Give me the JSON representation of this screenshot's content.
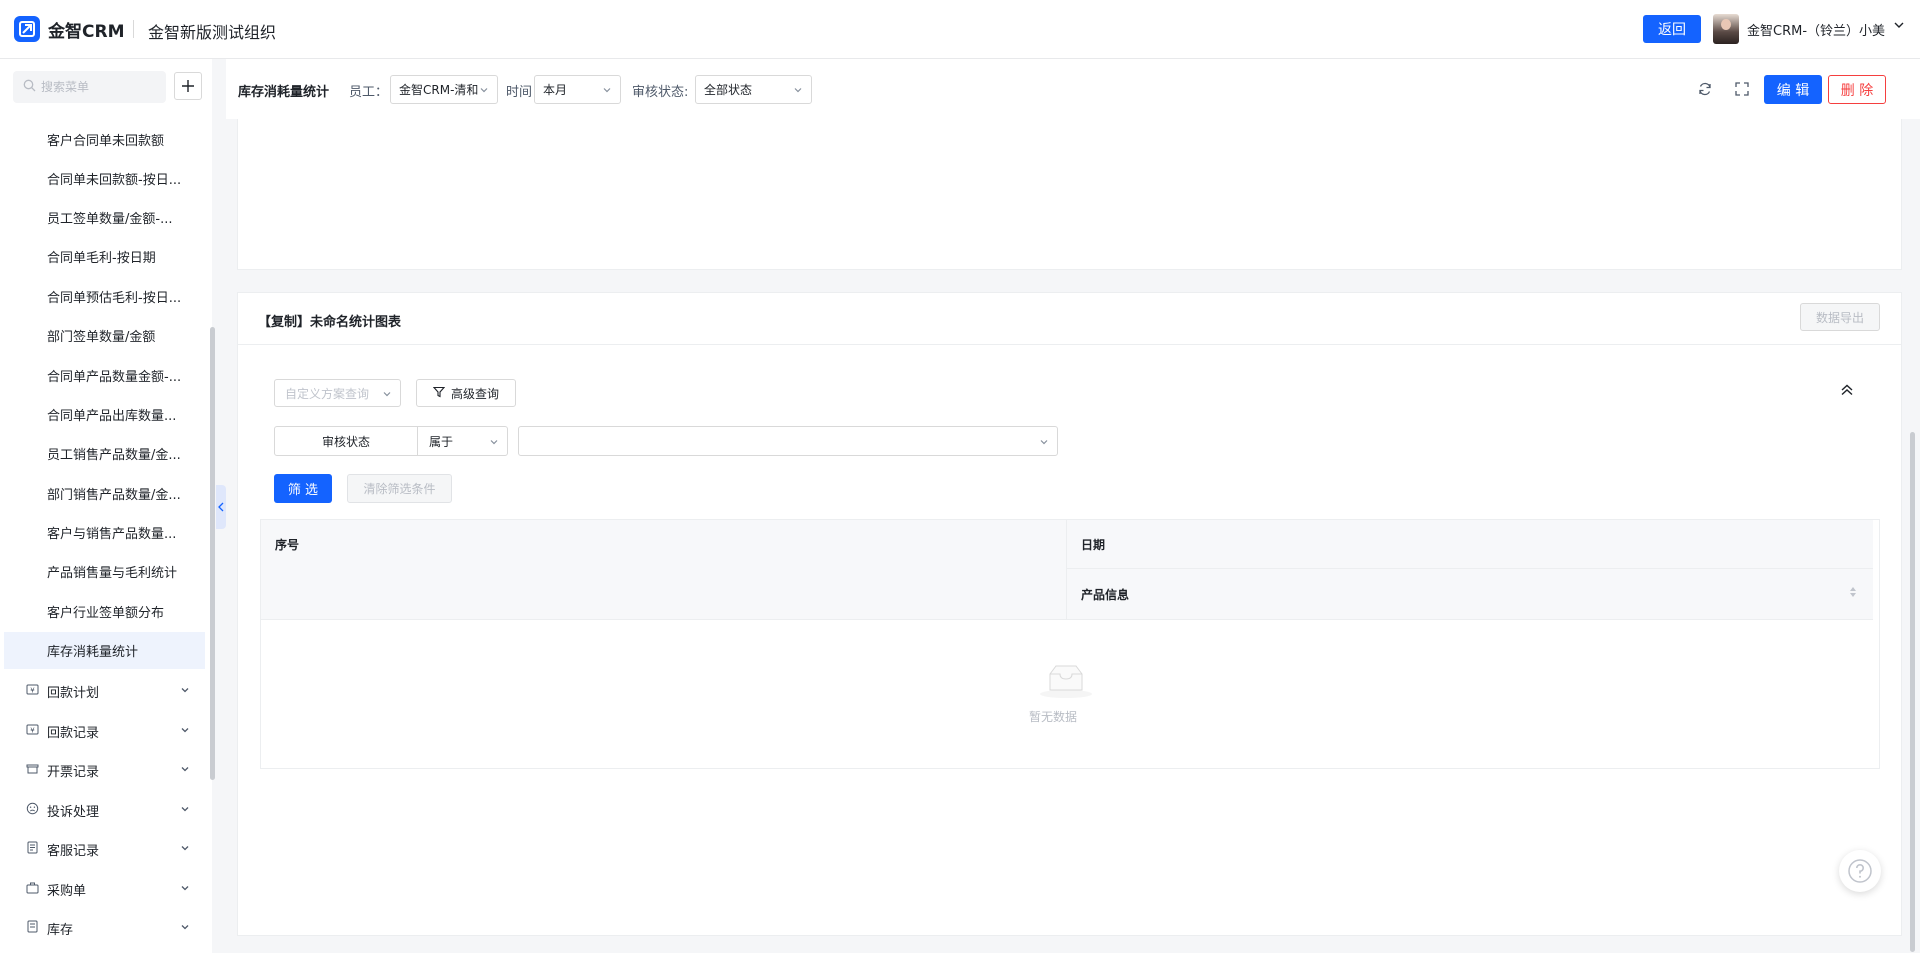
{
  "topbar": {
    "logo_text": "金智CRM",
    "org_name": "金智新版测试组织",
    "back_label": "返回",
    "user_name": "金智CRM-（铃兰）小美"
  },
  "sidebar": {
    "search_placeholder": "搜索菜单",
    "items": [
      {
        "label": "客户合同单未回款额"
      },
      {
        "label": "合同单未回款额-按日..."
      },
      {
        "label": "员工签单数量/金额-..."
      },
      {
        "label": "合同单毛利-按日期"
      },
      {
        "label": "合同单预估毛利-按日..."
      },
      {
        "label": "部门签单数量/金额"
      },
      {
        "label": "合同单产品数量金额-..."
      },
      {
        "label": "合同单产品出库数量..."
      },
      {
        "label": "员工销售产品数量/金..."
      },
      {
        "label": "部门销售产品数量/金..."
      },
      {
        "label": "客户与销售产品数量..."
      },
      {
        "label": "产品销售量与毛利统计"
      },
      {
        "label": "客户行业签单额分布"
      },
      {
        "label": "库存消耗量统计"
      }
    ],
    "groups": [
      {
        "label": "回款计划",
        "icon": "payment-plan-icon"
      },
      {
        "label": "回款记录",
        "icon": "payment-record-icon"
      },
      {
        "label": "开票记录",
        "icon": "invoice-icon"
      },
      {
        "label": "投诉处理",
        "icon": "complaint-icon"
      },
      {
        "label": "客服记录",
        "icon": "service-record-icon"
      },
      {
        "label": "采购单",
        "icon": "purchase-icon"
      },
      {
        "label": "库存",
        "icon": "inventory-icon"
      }
    ]
  },
  "toolbar": {
    "title": "库存消耗量统计",
    "employee_label": "员工：",
    "employee_value": "金智CRM-清和",
    "time_label": "时间",
    "time_value": "本月",
    "audit_label": "审核状态:",
    "audit_value": "全部状态",
    "edit_label": "编 辑",
    "delete_label": "删 除"
  },
  "chart_card": {
    "title": "【复制】未命名统计图表",
    "export_label": "数据导出",
    "scheme_placeholder": "自定义方案查询",
    "advanced_label": "高级查询",
    "condition_field": "审核状态",
    "condition_op": "属于",
    "filter_label": "筛 选",
    "clear_label": "清除筛选条件",
    "columns": {
      "no": "序号",
      "date": "日期",
      "product": "产品信息"
    },
    "empty_text": "暂无数据"
  },
  "colors": {
    "primary": "#1463ff",
    "danger": "#f53f3f",
    "active_bg": "#eef3fd"
  }
}
